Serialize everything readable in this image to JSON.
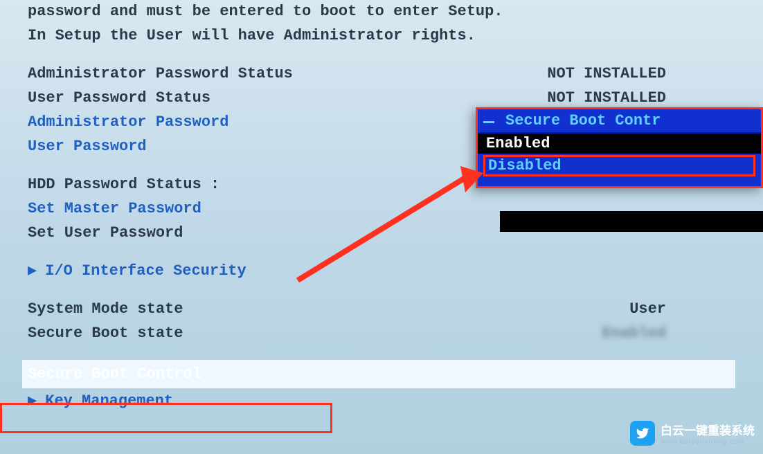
{
  "header": {
    "line1": "password and must be entered to boot to enter Setup.",
    "line2": "In Setup the User will have Administrator rights."
  },
  "status": {
    "admin_password_status_label": "Administrator Password Status",
    "admin_password_status_value": "NOT INSTALLED",
    "user_password_status_label": "User Password Status",
    "user_password_status_value": "NOT INSTALLED"
  },
  "password_items": {
    "admin_password": "Administrator Password",
    "user_password": "User Password",
    "hdd_password_status": "HDD Password Status  :",
    "set_master_password": "Set Master Password",
    "set_user_password": "Set User Password"
  },
  "submenu": {
    "io_interface_security": "I/O Interface Security"
  },
  "mode_state": {
    "system_mode_label": "System Mode state",
    "system_mode_value": "User",
    "secure_boot_label": "Secure Boot state",
    "secure_boot_value": "Enabled"
  },
  "bottom_items": {
    "secure_boot_control": "Secure Boot Control",
    "key_management": "Key Management"
  },
  "popup": {
    "title": "Secure Boot Contr",
    "option_enabled": "Enabled",
    "option_disabled": "Disabled"
  },
  "watermark": {
    "main_text": "白云一键重装系统",
    "sub_text": "www.baiyunxitong.com"
  }
}
